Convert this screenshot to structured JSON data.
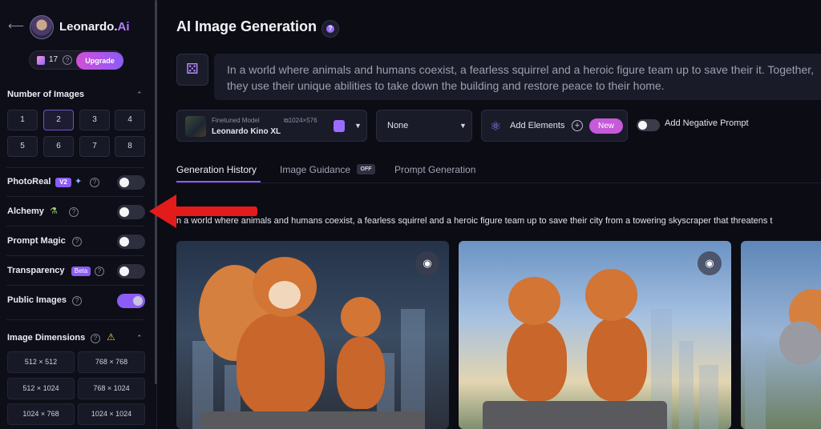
{
  "brand": {
    "name": "Leonardo.",
    "suffix": "Ai"
  },
  "account": {
    "token_count": "17",
    "help": "?",
    "upgrade_label": "Upgrade"
  },
  "sidebar": {
    "number_of_images": {
      "title": "Number of Images",
      "options": [
        "1",
        "2",
        "3",
        "4",
        "5",
        "6",
        "7",
        "8"
      ],
      "selected": "2"
    },
    "settings": [
      {
        "label": "PhotoReal",
        "badge": "V2",
        "enabled": false
      },
      {
        "label": "Alchemy",
        "enabled": false
      },
      {
        "label": "Prompt Magic",
        "enabled": false
      },
      {
        "label": "Transparency",
        "badge": "Beta",
        "enabled": false
      },
      {
        "label": "Public Images",
        "enabled": true
      }
    ],
    "image_dimensions": {
      "title": "Image Dimensions",
      "options": [
        "512 × 512",
        "768 × 768",
        "512 × 1024",
        "768 × 1024",
        "1024 × 768",
        "1024 × 1024"
      ]
    }
  },
  "main": {
    "title": "AI Image Generation",
    "prompt": "In a world where animals and humans coexist, a fearless squirrel and a heroic figure team up to save their city from a towering skyscraper that threatens to destroy it. Together, they use their unique abilities to take down the building and restore peace to their home.",
    "prompt_visible": "In a world where animals and humans coexist, a fearless squirrel and a heroic figure team up to save their it. Together, they use their unique abilities to take down the building and restore peace to their home.",
    "model": {
      "sublabel": "Finetuned Model",
      "resolution": "1024×576",
      "name": "Leonardo Kino XL"
    },
    "style_select": "None",
    "elements": {
      "label": "Add Elements",
      "plus": "+",
      "new_badge": "New"
    },
    "negative_prompt": {
      "label": "Add Negative Prompt",
      "enabled": false
    },
    "tabs": [
      {
        "label": "Generation History",
        "active": true
      },
      {
        "label": "Image Guidance",
        "badge": "OFF"
      },
      {
        "label": "Prompt Generation"
      }
    ],
    "history_prompt": "n a world where animals and humans coexist, a fearless squirrel and a heroic figure team up to save their city from a towering skyscraper that threatens t"
  },
  "icons": {
    "back": "back-arrow-icon",
    "eye": "eye-icon",
    "dice": "dice-icon",
    "atom": "atom-icon",
    "help": "question-icon",
    "warning": "warning-icon",
    "chevron": "chevron-up-icon"
  },
  "colors": {
    "accent": "#8b5cf6",
    "annotation_arrow": "#e41b1b",
    "background": "#0b0c14"
  }
}
